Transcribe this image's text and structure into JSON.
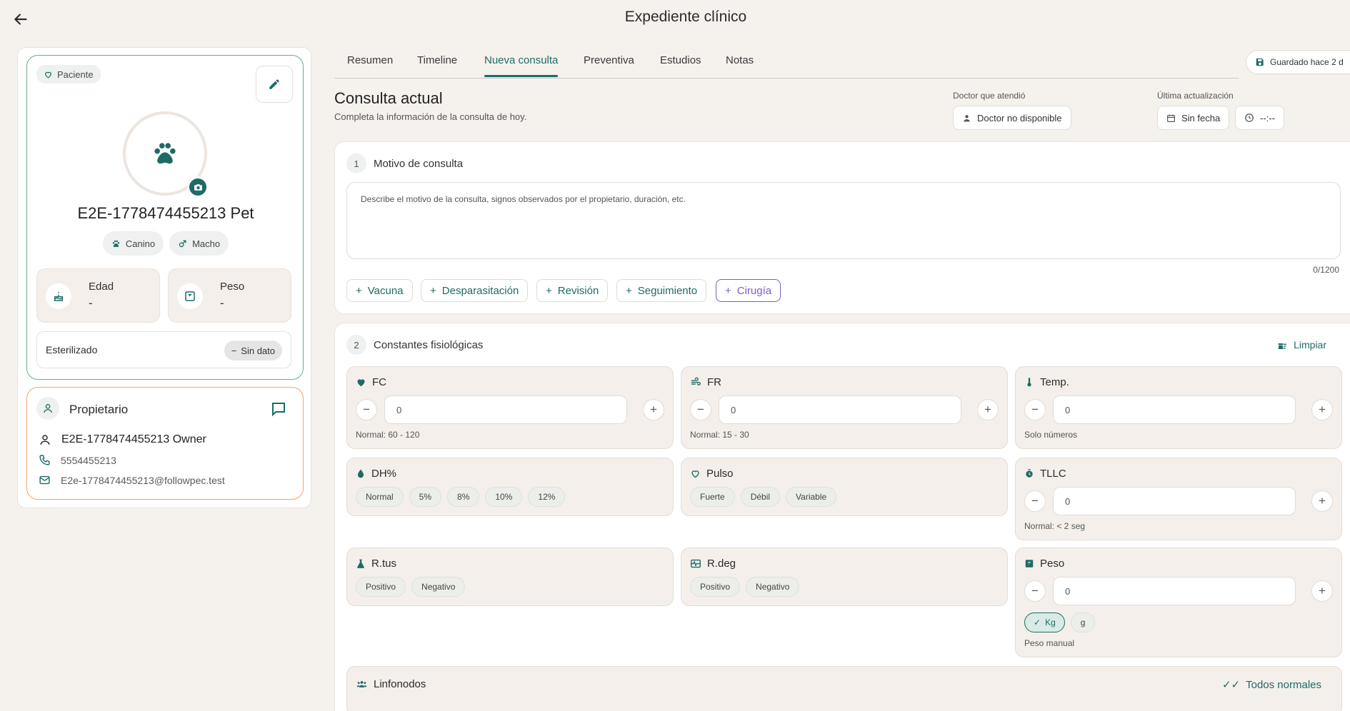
{
  "header": {
    "title": "Expediente clínico"
  },
  "patient": {
    "badge": "Paciente",
    "name": "E2E-1778474455213 Pet",
    "species": "Canino",
    "sex": "Macho",
    "age_label": "Edad",
    "age_value": "-",
    "weight_label": "Peso",
    "weight_value": "-",
    "sterilized_label": "Esterilizado",
    "sterilized_value": "Sin dato"
  },
  "owner": {
    "title": "Propietario",
    "name": "E2E-1778474455213 Owner",
    "phone": "5554455213",
    "email": "E2e-1778474455213@followpec.test"
  },
  "tabs": [
    "Resumen",
    "Timeline",
    "Nueva consulta",
    "Preventiva",
    "Estudios",
    "Notas"
  ],
  "active_tab": "Nueva consulta",
  "saved_status": "Guardado hace 2 d",
  "consult": {
    "title": "Consulta actual",
    "subtitle": "Completa la información de la consulta de hoy.",
    "doctor_label": "Doctor que atendió",
    "doctor_value": "Doctor no disponible",
    "updated_label": "Última actualización",
    "date_value": "Sin fecha",
    "time_value": "--:--"
  },
  "reason": {
    "number": "1",
    "title": "Motivo de consulta",
    "placeholder": "Describe el motivo de la consulta, signos observados por el propietario, duración, etc.",
    "counter": "0/1200",
    "quick_buttons": [
      "Vacuna",
      "Desparasitación",
      "Revisión",
      "Seguimiento",
      "Cirugía"
    ]
  },
  "vitals": {
    "number": "2",
    "title": "Constantes fisiológicas",
    "clear_label": "Limpiar",
    "fc": {
      "label": "FC",
      "value": "0",
      "note": "Normal: 60 - 120"
    },
    "fr": {
      "label": "FR",
      "value": "0",
      "note": "Normal: 15 - 30"
    },
    "temp": {
      "label": "Temp.",
      "value": "0",
      "note": "Solo números"
    },
    "dh": {
      "label": "DH%",
      "options": [
        "Normal",
        "5%",
        "8%",
        "10%",
        "12%"
      ]
    },
    "pulse": {
      "label": "Pulso",
      "options": [
        "Fuerte",
        "Débil",
        "Variable"
      ]
    },
    "tllc": {
      "label": "TLLC",
      "value": "0",
      "note": "Normal: < 2 seg"
    },
    "rtus": {
      "label": "R.tus",
      "options": [
        "Positivo",
        "Negativo"
      ]
    },
    "rdeg": {
      "label": "R.deg",
      "options": [
        "Positivo",
        "Negativo"
      ]
    },
    "weight": {
      "label": "Peso",
      "value": "0",
      "unit_kg": "Kg",
      "unit_g": "g",
      "selected_unit": "Kg",
      "note": "Peso manual"
    },
    "lymph": {
      "label": "Linfonodos",
      "all_normal": "Todos normales"
    }
  },
  "colors": {
    "accent": "#1e6b66",
    "patient_border": "#66b088",
    "owner_border": "#f0a56b",
    "surgery": "#7e5bd0",
    "background": "#f5f1ed"
  }
}
